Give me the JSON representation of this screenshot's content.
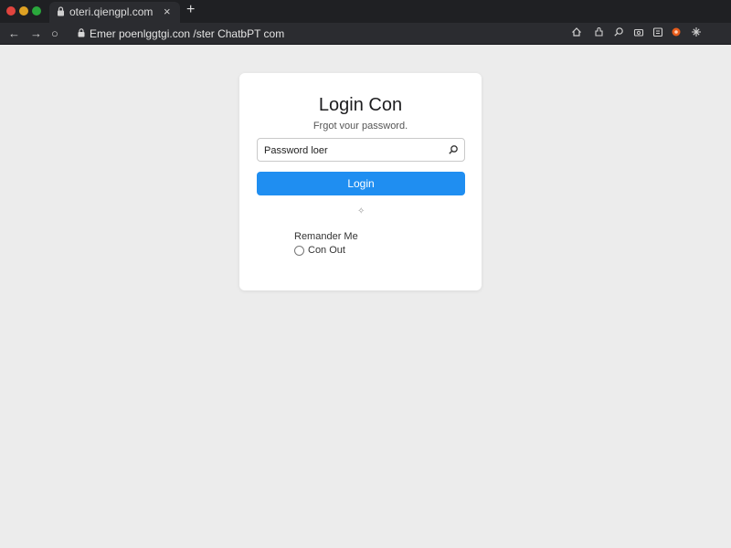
{
  "browser": {
    "tab": {
      "title": "oteri.qiengpl.com",
      "close": "×"
    },
    "new_tab": "+",
    "nav": {
      "back": "←",
      "forward": "→",
      "reload": "○"
    },
    "address": "Emer poenlggtgi.con /ster ChatbPT com",
    "toolbar_icons": [
      "home-icon",
      "puzzle-icon",
      "search-icon",
      "camera-icon",
      "extension-icon",
      "sparkle-icon"
    ],
    "colors": {
      "close": "#e0443e",
      "minimize": "#dea123",
      "maximize": "#2aa83c",
      "extension": "#e85d1c"
    }
  },
  "login": {
    "title": "Login Con",
    "subtitle": "Frgot vour password.",
    "password_placeholder": "Password loer",
    "login_label": "Login",
    "sparkle": "✧",
    "remember_label": "Remander Me",
    "radio_label": "Con Out",
    "accent": "#1f8ef1"
  }
}
